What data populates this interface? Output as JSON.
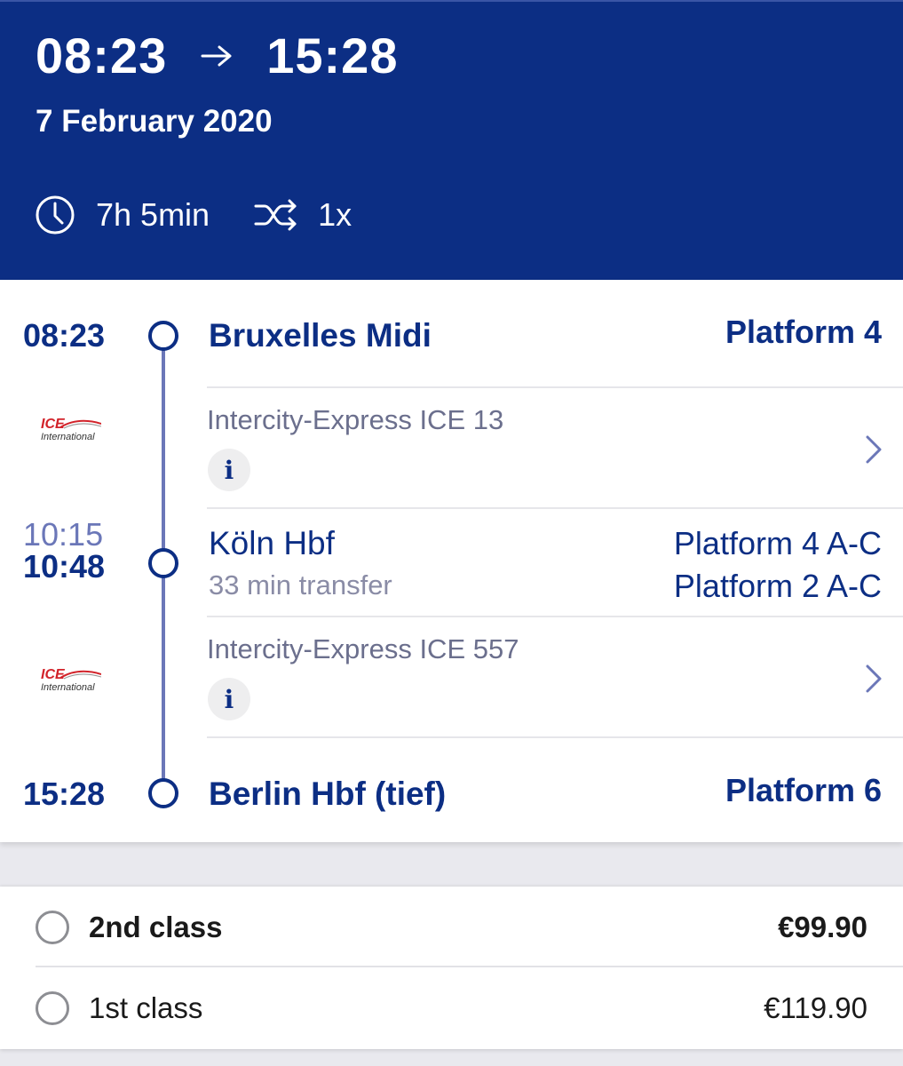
{
  "header": {
    "departure_time": "08:23",
    "arrival_time": "15:28",
    "date": "7 February 2020",
    "duration": "7h 5min",
    "changes": "1x",
    "icons": {
      "arrow": "arrow-right-icon",
      "clock": "clock-icon",
      "changes": "shuffle-icon"
    }
  },
  "journey": {
    "stops": [
      {
        "time": "08:23",
        "station": "Bruxelles Midi",
        "platform": "Platform 4"
      },
      {
        "arr_time": "10:15",
        "dep_time": "10:48",
        "station": "Köln Hbf",
        "transfer": "33 min transfer",
        "platform_arr": "Platform 4 A-C",
        "platform_dep": "Platform 2 A-C"
      },
      {
        "time": "15:28",
        "station": "Berlin Hbf (tief)",
        "platform": "Platform 6"
      }
    ],
    "legs": [
      {
        "train": "Intercity-Express ICE 13",
        "logo_top": "ICE",
        "logo_bottom": "International",
        "info": "i"
      },
      {
        "train": "Intercity-Express ICE 557",
        "logo_top": "ICE",
        "logo_bottom": "International",
        "info": "i"
      }
    ]
  },
  "fares": [
    {
      "label": "2nd class",
      "price": "€99.90",
      "emphasis": true
    },
    {
      "label": "1st class",
      "price": "€119.90",
      "emphasis": false
    }
  ],
  "colors": {
    "brand_navy": "#0c2e84",
    "timeline": "#6b77b8",
    "ice_red": "#d2232a",
    "muted": "#6b6f8d"
  }
}
